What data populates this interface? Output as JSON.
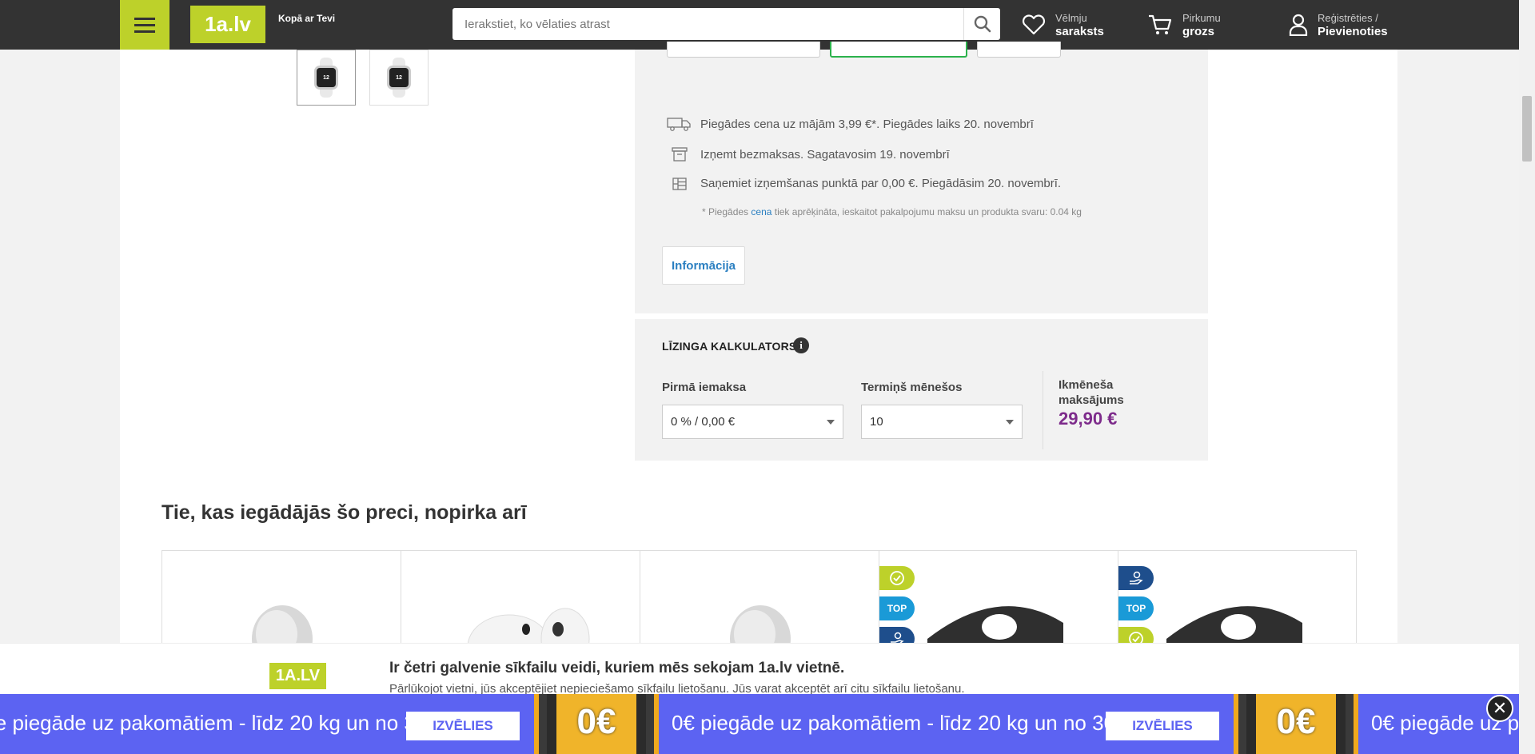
{
  "header": {
    "logo": "1a.lv",
    "tagline": "Kopā ar Tevi",
    "search_placeholder": "Ierakstiet, ko vēlaties atrast",
    "wishlist": {
      "line1": "Vēlmju",
      "line2": "saraksts"
    },
    "cart": {
      "line1": "Pirkumu",
      "line2": "grozs"
    },
    "account": {
      "line1": "Reģistrēties /",
      "line2": "Pievienoties"
    }
  },
  "gallery": {
    "thumb_watch_label": "12"
  },
  "delivery": {
    "rows": [
      {
        "icon": "truck-icon",
        "text": "Piegādes cena uz mājām 3,99 €*. Piegādes laiks 20. novembrī"
      },
      {
        "icon": "store-box-icon",
        "text": "Izņemt bezmaksas. Sagatavosim 19. novembrī"
      },
      {
        "icon": "parcel-locker-icon",
        "text": "Saņemiet izņemšanas punktā par 0,00 €. Piegādāsim 20. novembrī."
      }
    ],
    "note_prefix": "* Piegādes ",
    "note_link": "cena",
    "note_suffix": " tiek aprēķināta, ieskaitot pakalpojumu maksu un produkta svaru: 0.04 kg",
    "info_button": "Informācija"
  },
  "leasing": {
    "title": "LĪZINGA KALKULATORS",
    "info_icon_char": "i",
    "first_payment_label": "Pirmā iemaksa",
    "first_payment_value": "0 % / 0,00 €",
    "term_label": "Termiņš mēnešos",
    "term_value": "10",
    "monthly_label": "Ikmēneša maksājums",
    "monthly_value": "29,90 €"
  },
  "recommendations": {
    "title": "Tie, kas iegādājās šo preci, nopirka arī",
    "badge_top": "TOP"
  },
  "cookie": {
    "logo": "1A.LV",
    "title": "Ir četri galvenie sīkfailu veidi, kuriem mēs sekojam 1a.lv vietnē.",
    "text": "Pārlūkojot vietni, jūs akceptējiet nepieciešamo sīkfailu lietošanu. Jūs varat akceptēt arī citu sīkfailu lietošanu."
  },
  "banner": {
    "text": "0€ piegāde uz pakomātiem - līdz 20 kg un no 30 €",
    "text_left": "ie piegāde uz pakomātiem - līdz 20 kg un no 30 €",
    "text_right": "0€ piegāde uz pa",
    "button": "IZVĒLIES",
    "image_text": "0€",
    "close_char": "✕"
  },
  "colors": {
    "brand_green": "#bdd12a",
    "header_bg": "#333333",
    "banner_bg": "#5c63f2",
    "price_purple": "#7d2b8b",
    "link_blue": "#2a7fc1"
  }
}
